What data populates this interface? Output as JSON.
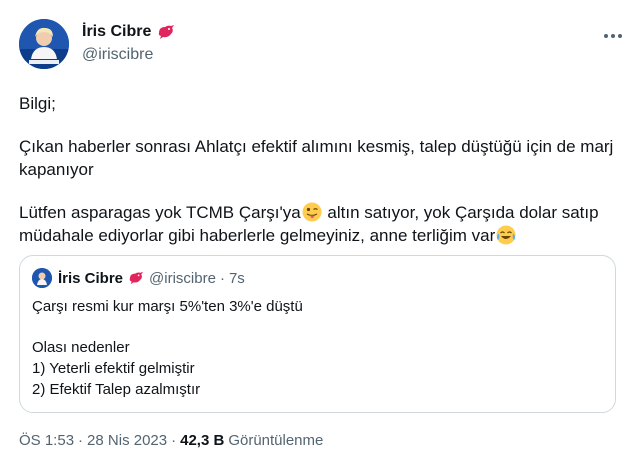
{
  "author": {
    "display_name": "İris Cibre",
    "handle": "@iriscibre"
  },
  "tweet": {
    "line1": "Bilgi;",
    "para2": "Çıkan haberler sonrası Ahlatçı efektif alımını kesmiş, talep düştüğü için de marj kapanıyor",
    "para3_a": "Lütfen asparagas yok TCMB Çarşı'ya",
    "para3_b": " altın satıyor, yok Çarşıda dolar satıp müdahale ediyorlar gibi haberlerle gelmeyiniz, anne terliğim var",
    "emoji1": "winking-face-with-tongue",
    "emoji2": "face-with-tears-of-joy"
  },
  "quote": {
    "display_name": "İris Cibre",
    "handle": "@iriscibre",
    "separator": "·",
    "time": "7s",
    "line1": "Çarşı resmi kur marşı 5%'ten 3%'e düştü",
    "line2": "Olası nedenler",
    "line3": "1) Yeterli efektif gelmiştir",
    "line4": "2) Efektif Talep azalmıştır"
  },
  "meta": {
    "time": "ÖS 1:53",
    "sep1": "·",
    "date": "28 Nis 2023",
    "sep2": "·",
    "views_count": "42,3 B",
    "views_label": "Görüntülenme"
  },
  "colors": {
    "text": "#0f1419",
    "secondary": "#536471",
    "border": "#cfd9de",
    "bird": "#e0245e"
  }
}
